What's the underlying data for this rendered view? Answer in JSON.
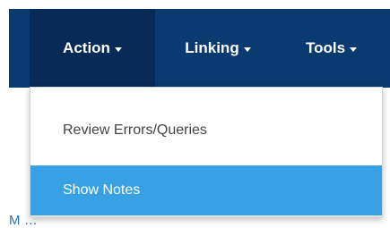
{
  "nav": {
    "items": [
      {
        "label": "Action",
        "active": true
      },
      {
        "label": "Linking",
        "active": false
      },
      {
        "label": "Tools",
        "active": false
      }
    ]
  },
  "dropdown": {
    "items": [
      {
        "label": "Review Errors/Queries",
        "highlighted": false
      },
      {
        "label": "Show Notes",
        "highlighted": true
      }
    ]
  },
  "background": {
    "partial_text": "M  ..."
  },
  "colors": {
    "navbar": "#0b3a70",
    "navbar_active": "#072a56",
    "dropdown_highlight": "#38a1e6",
    "dropdown_text": "#444444"
  }
}
